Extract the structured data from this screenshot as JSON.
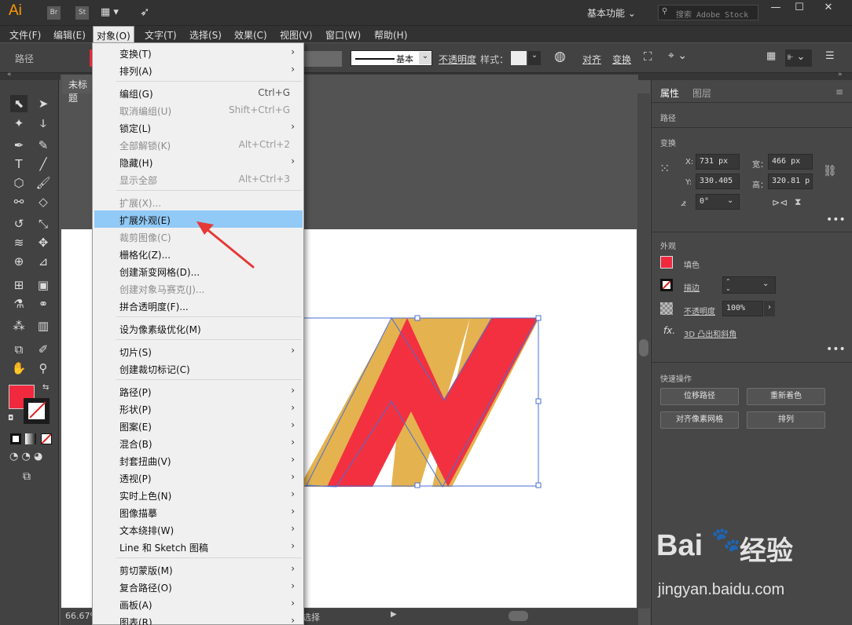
{
  "app": {
    "logo": "Ai",
    "bridge": "Br",
    "stock": "St",
    "workspace": "基本功能",
    "search_placeholder": "搜索 Adobe Stock"
  },
  "menubar": [
    "文件(F)",
    "编辑(E)",
    "对象(O)",
    "文字(T)",
    "选择(S)",
    "效果(C)",
    "视图(V)",
    "窗口(W)",
    "帮助(H)"
  ],
  "control": {
    "path_label": "路径",
    "stroke_style": "基本",
    "opacity_label": "不透明度",
    "style_label": "样式：",
    "align": "对齐",
    "transform": "变换"
  },
  "doc_tab": "未标题",
  "status": {
    "zoom": "66.67%",
    "tool": "选择"
  },
  "panel": {
    "tabs": [
      "属性",
      "图层"
    ],
    "path_label": "路径",
    "transform_title": "变换",
    "x_label": "X:",
    "x": "731 px",
    "y_label": "Y:",
    "y": "330.405",
    "w_label": "宽：",
    "w": "466 px",
    "h_label": "高：",
    "h": "320.81 p",
    "angle": "0°",
    "appearance_title": "外观",
    "fill_label": "填色",
    "stroke_label": "描边",
    "opacity_label": "不透明度",
    "opacity": "100%",
    "fx": "fx.",
    "effect": "3D 凸出和斜角",
    "quick_title": "快速操作",
    "quick_buttons": [
      "位移路径",
      "重新着色",
      "对齐像素网格",
      "排列"
    ]
  },
  "menu": [
    {
      "label": "变换(T)",
      "shortcut": "",
      "arrow": true,
      "disabled": false
    },
    {
      "label": "排列(A)",
      "shortcut": "",
      "arrow": true,
      "disabled": false
    },
    {
      "sep": true
    },
    {
      "label": "编组(G)",
      "shortcut": "Ctrl+G",
      "arrow": false,
      "disabled": false
    },
    {
      "label": "取消编组(U)",
      "shortcut": "Shift+Ctrl+G",
      "arrow": false,
      "disabled": true
    },
    {
      "label": "锁定(L)",
      "shortcut": "",
      "arrow": true,
      "disabled": false
    },
    {
      "label": "全部解锁(K)",
      "shortcut": "Alt+Ctrl+2",
      "arrow": false,
      "disabled": true
    },
    {
      "label": "隐藏(H)",
      "shortcut": "",
      "arrow": true,
      "disabled": false
    },
    {
      "label": "显示全部",
      "shortcut": "Alt+Ctrl+3",
      "arrow": false,
      "disabled": true
    },
    {
      "sep": true
    },
    {
      "label": "扩展(X)...",
      "shortcut": "",
      "arrow": false,
      "disabled": true
    },
    {
      "label": "扩展外观(E)",
      "shortcut": "",
      "arrow": false,
      "disabled": false,
      "highlight": true
    },
    {
      "label": "裁剪图像(C)",
      "shortcut": "",
      "arrow": false,
      "disabled": true
    },
    {
      "label": "栅格化(Z)...",
      "shortcut": "",
      "arrow": false,
      "disabled": false
    },
    {
      "label": "创建渐变网格(D)...",
      "shortcut": "",
      "arrow": false,
      "disabled": false
    },
    {
      "label": "创建对象马赛克(J)...",
      "shortcut": "",
      "arrow": false,
      "disabled": true
    },
    {
      "label": "拼合透明度(F)...",
      "shortcut": "",
      "arrow": false,
      "disabled": false
    },
    {
      "sep": true
    },
    {
      "label": "设为像素级优化(M)",
      "shortcut": "",
      "arrow": false,
      "disabled": false
    },
    {
      "sep": true
    },
    {
      "label": "切片(S)",
      "shortcut": "",
      "arrow": true,
      "disabled": false
    },
    {
      "label": "创建裁切标记(C)",
      "shortcut": "",
      "arrow": false,
      "disabled": false
    },
    {
      "sep": true
    },
    {
      "label": "路径(P)",
      "shortcut": "",
      "arrow": true,
      "disabled": false
    },
    {
      "label": "形状(P)",
      "shortcut": "",
      "arrow": true,
      "disabled": false
    },
    {
      "label": "图案(E)",
      "shortcut": "",
      "arrow": true,
      "disabled": false
    },
    {
      "label": "混合(B)",
      "shortcut": "",
      "arrow": true,
      "disabled": false
    },
    {
      "label": "封套扭曲(V)",
      "shortcut": "",
      "arrow": true,
      "disabled": false
    },
    {
      "label": "透视(P)",
      "shortcut": "",
      "arrow": true,
      "disabled": false
    },
    {
      "label": "实时上色(N)",
      "shortcut": "",
      "arrow": true,
      "disabled": false
    },
    {
      "label": "图像描摹",
      "shortcut": "",
      "arrow": true,
      "disabled": false
    },
    {
      "label": "文本绕排(W)",
      "shortcut": "",
      "arrow": true,
      "disabled": false
    },
    {
      "label": "Line 和 Sketch 图稿",
      "shortcut": "",
      "arrow": true,
      "disabled": false
    },
    {
      "sep": true
    },
    {
      "label": "剪切蒙版(M)",
      "shortcut": "",
      "arrow": true,
      "disabled": false
    },
    {
      "label": "复合路径(O)",
      "shortcut": "",
      "arrow": true,
      "disabled": false
    },
    {
      "label": "画板(A)",
      "shortcut": "",
      "arrow": true,
      "disabled": false
    },
    {
      "label": "图表(R)",
      "shortcut": "",
      "arrow": true,
      "disabled": false
    }
  ],
  "colors": {
    "fill": "#f0293e",
    "shape_red": "#f23040",
    "shape_gold": "#e4b24f",
    "highlight": "#91c9f7"
  },
  "watermark": {
    "brand_left": "Bai",
    "brand_right": "经验",
    "url": "jingyan.baidu.com"
  }
}
